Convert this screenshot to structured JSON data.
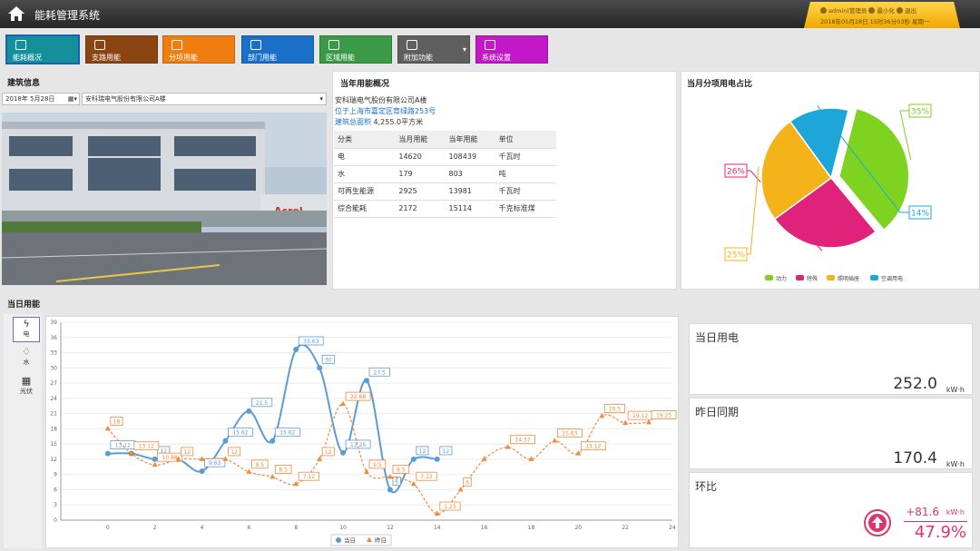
{
  "header": {
    "title": "能耗管理系统",
    "user_line": "admin(管理员",
    "user_min": "最小化",
    "user_exit": "退出",
    "datetime": "2018年05月28日 15时36分03秒 星期一"
  },
  "nav": [
    {
      "label": "能耗概况",
      "color": "#13909a",
      "icon": "bar-chart-icon"
    },
    {
      "label": "支路用能",
      "color": "#8a4513",
      "icon": "line-chart-icon"
    },
    {
      "label": "分项用能",
      "color": "#f07d0f",
      "icon": "user-icon"
    },
    {
      "label": "部门用能",
      "color": "#1a6fc8",
      "icon": "box-icon"
    },
    {
      "label": "区域用能",
      "color": "#3a9a47",
      "icon": "grid-icon"
    },
    {
      "label": "附加功能",
      "color": "#5f5f5f",
      "icon": "pulse-icon"
    },
    {
      "label": "系统设置",
      "color": "#c218c8",
      "icon": "gear-icon"
    }
  ],
  "building": {
    "title": "建筑信息",
    "date": "2018年  5月28日",
    "company_select": "安科瑞电气股份有限公司A楼",
    "sign": "Acrel"
  },
  "yearly": {
    "title": "当年用能概况",
    "company": "安科瑞电气股份有限公司A楼",
    "address": "位于上海市嘉定区育绿路253号",
    "area_label": "建筑总面积",
    "area_value": "4,255.0平方米",
    "headers": [
      "分类",
      "当月用能",
      "当年用能",
      "单位"
    ],
    "rows": [
      [
        "电",
        "14620",
        "108439",
        "千瓦时"
      ],
      [
        "水",
        "179",
        "803",
        "吨"
      ],
      [
        "可再生能源",
        "2925",
        "13981",
        "千瓦时"
      ],
      [
        "综合能耗",
        "2172",
        "15114",
        "千克标准煤"
      ]
    ]
  },
  "pie_panel": {
    "title": "当月分项用电占比"
  },
  "daily": {
    "title": "当日用能",
    "side": [
      "电",
      "水",
      "光伏"
    ]
  },
  "stats": {
    "today_label": "当日用电",
    "today_value": "252.0",
    "yday_label": "昨日同期",
    "yday_value": "170.4",
    "ratio_label": "环比",
    "diff": "+81.6",
    "pct": "47.9%",
    "unit": "kW·h"
  },
  "chart_data": [
    {
      "type": "pie",
      "slices": [
        {
          "name": "动力",
          "value": 35,
          "label": "35%",
          "color": "#7ed321"
        },
        {
          "name": "特殊",
          "value": 26,
          "label": "26%",
          "color": "#e0237a"
        },
        {
          "name": "照明插座",
          "value": 25,
          "label": "25%",
          "color": "#f5b31a"
        },
        {
          "name": "空调用电",
          "value": 14,
          "label": "14%",
          "color": "#1da7d8"
        }
      ]
    },
    {
      "type": "line",
      "xlim": [
        -2,
        24
      ],
      "ylim": [
        0,
        39
      ],
      "xticks": [
        0,
        2,
        4,
        6,
        8,
        10,
        12,
        14,
        16,
        18,
        20,
        22,
        24
      ],
      "yticks": [
        0,
        3,
        6,
        9,
        12,
        15,
        18,
        21,
        24,
        27,
        30,
        33,
        36,
        39
      ],
      "series": [
        {
          "name": "当日",
          "color": "#5b9bd5",
          "points": [
            [
              0,
              13.12
            ],
            [
              1,
              13.12
            ],
            [
              2,
              12
            ],
            [
              3,
              12
            ],
            [
              4,
              9.63
            ],
            [
              5,
              15.62
            ],
            [
              6,
              21.5
            ],
            [
              7,
              15.62
            ],
            [
              8,
              33.63
            ],
            [
              9,
              30
            ],
            [
              10,
              13.25
            ],
            [
              11,
              27.5
            ],
            [
              12,
              6
            ],
            [
              13,
              12
            ],
            [
              14,
              12
            ]
          ],
          "labels": [
            "13.12",
            "",
            "12",
            "",
            "9.63",
            "15.62",
            "21.5",
            "15.62",
            "33.63",
            "30",
            "13.25",
            "27.5",
            "6",
            "12",
            "12"
          ]
        },
        {
          "name": "昨日",
          "color": "#f08a3e",
          "points": [
            [
              0,
              18
            ],
            [
              1,
              13.12
            ],
            [
              2,
              10.88
            ],
            [
              3,
              12
            ],
            [
              4,
              12
            ],
            [
              5,
              12
            ],
            [
              6,
              9.5
            ],
            [
              7,
              8.5
            ],
            [
              8,
              7.12
            ],
            [
              9,
              12
            ],
            [
              10,
              22.88
            ],
            [
              11,
              9.5
            ],
            [
              12,
              8.5
            ],
            [
              13,
              7.12
            ],
            [
              14,
              1.25
            ],
            [
              15,
              6
            ],
            [
              16,
              12
            ],
            [
              17,
              14.37
            ],
            [
              18,
              12
            ],
            [
              19,
              15.63
            ],
            [
              20,
              13.12
            ],
            [
              21,
              20.5
            ],
            [
              22,
              19.12
            ],
            [
              23,
              19.25
            ]
          ],
          "labels": [
            "18",
            "13.12",
            "10.88",
            "12",
            "",
            "12",
            "9.5",
            "8.5",
            "7.12",
            "12",
            "22.88",
            "9.5",
            "8.5",
            "7.12",
            "1.25",
            "6",
            "",
            "14.37",
            "",
            "15.63",
            "13.12",
            "20.5",
            "19.12",
            "19.25"
          ]
        }
      ]
    }
  ]
}
